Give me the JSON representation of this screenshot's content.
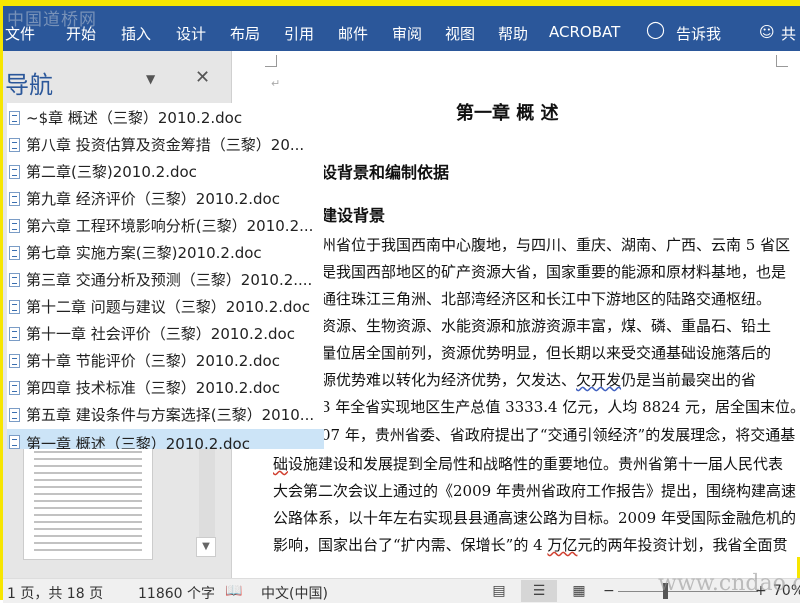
{
  "watermark_top": "中国道桥网",
  "watermark_bottom": "www.cndao.com",
  "ribbon": {
    "tabs": [
      "文件",
      "开始",
      "插入",
      "设计",
      "布局",
      "引用",
      "邮件",
      "审阅",
      "视图",
      "帮助",
      "ACROBAT"
    ],
    "tell_me": "告诉我",
    "share": "共"
  },
  "nav": {
    "title": "导航",
    "items": [
      "~$章 概述（三黎）2010.2.doc",
      "第八章  投资估算及资金筹措（三黎）20...",
      "第二章(三黎)2010.2.doc",
      "第九章 经济评价（三黎）2010.2.doc",
      "第六章 工程环境影响分析(三黎）2010.2...",
      "第七章 实施方案(三黎)2010.2.doc",
      "第三章 交通分析及预测（三黎）2010.2....",
      "第十二章 问题与建议（三黎）2010.2.doc",
      "第十一章 社会评价（三黎）2010.2.doc",
      "第十章 节能评价（三黎）2010.2.doc",
      "第四章 技术标准（三黎）2010.2.doc",
      "第五章 建设条件与方案选择(三黎）2010...",
      "第一章 概述（三黎）2010.2.doc"
    ],
    "selected_index": 12
  },
  "doc": {
    "title": "第一章   概   述",
    "heading1": "设背景和编制依据",
    "heading2": "建设背景",
    "lines": [
      "州省位于我国西南中心腹地，与四川、重庆、湖南、广西、云南 5 省区",
      "是我国西部地区的矿产资源大省，国家重要的能源和原材料基地，也是",
      "通往珠江三角洲、北部湾经济区和长江中下游地区的陆路交通枢纽。",
      "资源、生物资源、水能资源和旅游资源丰富，煤、磷、重晶石、铅土",
      "量位居全国前列，资源优势明显，但长期以来受交通基础设施落后的",
      "源优势难以转化为经济优势，欠发达、欠开发仍是当前最突出的省",
      "3 年全省实现地区生产总值 3333.4 亿元，人均 8824 元，居全国末位。",
      "07 年，贵州省委、省政府提出了“交通引领经济”的发展理念，将交通基",
      "础设施建设和发展提到全局性和战略性的重要地位。贵州省第十一届人民代表",
      "大会第二次会议上通过的《2009 年贵州省政府工作报告》提出，围绕构建高速",
      "公路体系，以十年左右实现县县通高速公路为目标。2009 年受国际金融危机的",
      "影响，国家出台了“扩内需、保增长”的 4 万亿元的两年投资计划，我省全面贯"
    ]
  },
  "status": {
    "page": "1 页，共 18 页",
    "words": "11860 个字",
    "language": "中文(中国)",
    "zoom": "70%"
  }
}
